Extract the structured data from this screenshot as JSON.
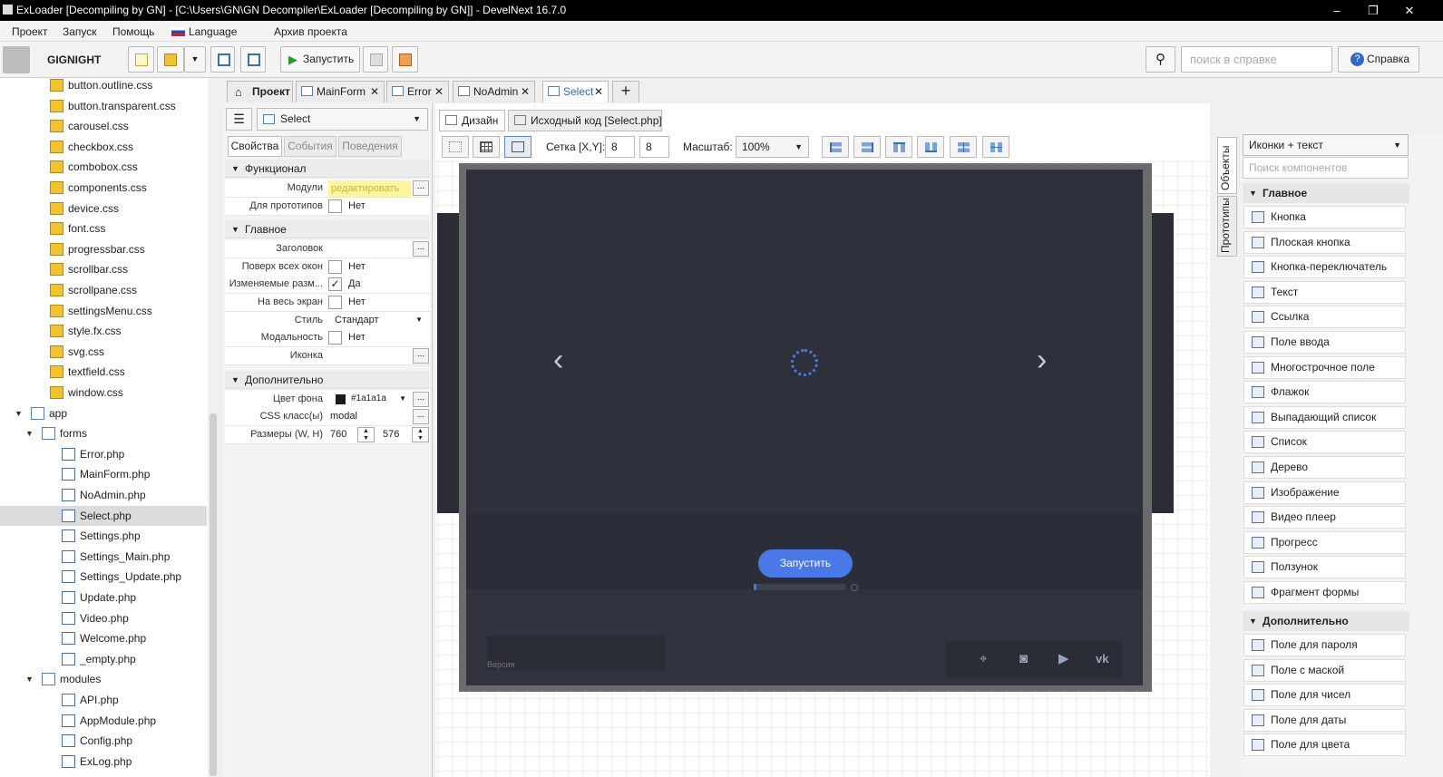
{
  "window": {
    "title": "ExLoader [Decompiling by GN] - [C:\\Users\\GN\\GN Decompiler\\ExLoader [Decompiling by GN]] - DevelNext 16.7.0",
    "minimize": "–",
    "maximize": "❐",
    "close": "✕"
  },
  "menu": {
    "project": "Проект",
    "run": "Запуск",
    "help": "Помощь",
    "language": "Language",
    "archive": "Архив проекта"
  },
  "toolbar": {
    "user": "GIGNIGHT",
    "run_label": "Запустить",
    "search_placeholder": "поиск в справке",
    "help_label": "Справка"
  },
  "tree": {
    "items": [
      {
        "label": "button.outline.css",
        "kind": "css",
        "depth": 2
      },
      {
        "label": "button.transparent.css",
        "kind": "css",
        "depth": 2
      },
      {
        "label": "carousel.css",
        "kind": "css",
        "depth": 2
      },
      {
        "label": "checkbox.css",
        "kind": "css",
        "depth": 2
      },
      {
        "label": "combobox.css",
        "kind": "css",
        "depth": 2
      },
      {
        "label": "components.css",
        "kind": "css",
        "depth": 2
      },
      {
        "label": "device.css",
        "kind": "css",
        "depth": 2
      },
      {
        "label": "font.css",
        "kind": "css",
        "depth": 2
      },
      {
        "label": "progressbar.css",
        "kind": "css",
        "depth": 2
      },
      {
        "label": "scrollbar.css",
        "kind": "css",
        "depth": 2
      },
      {
        "label": "scrollpane.css",
        "kind": "css",
        "depth": 2
      },
      {
        "label": "settingsMenu.css",
        "kind": "css",
        "depth": 2
      },
      {
        "label": "style.fx.css",
        "kind": "css",
        "depth": 2
      },
      {
        "label": "svg.css",
        "kind": "css",
        "depth": 2
      },
      {
        "label": "textfield.css",
        "kind": "css",
        "depth": 2
      },
      {
        "label": "window.css",
        "kind": "css",
        "depth": 2
      },
      {
        "label": "app",
        "kind": "folder",
        "depth": 0
      },
      {
        "label": "forms",
        "kind": "folder",
        "depth": 1
      },
      {
        "label": "Error.php",
        "kind": "php",
        "depth": 3
      },
      {
        "label": "MainForm.php",
        "kind": "php",
        "depth": 3
      },
      {
        "label": "NoAdmin.php",
        "kind": "php",
        "depth": 3
      },
      {
        "label": "Select.php",
        "kind": "php",
        "depth": 3,
        "selected": true
      },
      {
        "label": "Settings.php",
        "kind": "php",
        "depth": 3
      },
      {
        "label": "Settings_Main.php",
        "kind": "php",
        "depth": 3
      },
      {
        "label": "Settings_Update.php",
        "kind": "php",
        "depth": 3
      },
      {
        "label": "Update.php",
        "kind": "php",
        "depth": 3
      },
      {
        "label": "Video.php",
        "kind": "php",
        "depth": 3
      },
      {
        "label": "Welcome.php",
        "kind": "php",
        "depth": 3
      },
      {
        "label": "_empty.php",
        "kind": "php",
        "depth": 3
      },
      {
        "label": "modules",
        "kind": "folder",
        "depth": 1
      },
      {
        "label": "API.php",
        "kind": "php",
        "depth": 3
      },
      {
        "label": "AppModule.php",
        "kind": "php",
        "depth": 3
      },
      {
        "label": "Config.php",
        "kind": "php",
        "depth": 3
      },
      {
        "label": "ExLog.php",
        "kind": "php",
        "depth": 3
      }
    ]
  },
  "tabs": {
    "project": "Проект",
    "mainform": "MainForm",
    "error": "Error",
    "noadmin": "NoAdmin",
    "select": "Select",
    "add": "+"
  },
  "props": {
    "object_select": "Select",
    "tab_props": "Свойства",
    "tab_events": "События",
    "tab_behaviors": "Поведения",
    "sec_func": "Функционал",
    "modules_label": "Модули",
    "modules_value": "редактировать",
    "proto_label": "Для прототипов",
    "proto_value": "Нет",
    "sec_main": "Главное",
    "title_label": "Заголовок",
    "ontop_label": "Поверх всех окон",
    "ontop_value": "Нет",
    "resize_label": "Изменяемые разм...",
    "resize_value": "Да",
    "fullscreen_label": "На весь экран",
    "fullscreen_value": "Нет",
    "style_label": "Стиль",
    "style_value": "Стандарт",
    "modal_label": "Модальность",
    "modal_value": "Нет",
    "icon_label": "Иконка",
    "sec_extra": "Дополнительно",
    "bg_label": "Цвет фона",
    "bg_value": "#1a1a1a",
    "css_label": "CSS класс(ы)",
    "css_value": "modal",
    "size_label": "Размеры (W, H)",
    "width": "760",
    "height": "576"
  },
  "design": {
    "tab_design": "Дизайн",
    "tab_source": "Исходный код [Select.php]",
    "grid_label": "Сетка [X,Y]:",
    "grid_x": "8",
    "grid_y": "8",
    "scale_label": "Масштаб:",
    "scale_value": "100%"
  },
  "form": {
    "run_button": "Запустить",
    "version_label": "Версия",
    "progress": 0.03
  },
  "palette": {
    "vtab_objects": "Объекты",
    "vtab_protos": "Прототипы",
    "view_mode": "Иконки + текст",
    "search_placeholder": "Поиск компонентов",
    "sec_main": "Главное",
    "main_items": [
      "Кнопка",
      "Плоская кнопка",
      "Кнопка-переключатель",
      "Текст",
      "Ссылка",
      "Поле ввода",
      "Многострочное поле",
      "Флажок",
      "Выпадающий список",
      "Список",
      "Дерево",
      "Изображение",
      "Видео плеер",
      "Прогресс",
      "Ползунок",
      "Фрагмент формы"
    ],
    "sec_extra": "Дополнительно",
    "extra_items": [
      "Поле для пароля",
      "Поле с маской",
      "Поле для чисел",
      "Поле для даты",
      "Поле для цвета"
    ]
  },
  "colors": {
    "accent": "#4a78e6",
    "form_bg": "#2e313b"
  }
}
